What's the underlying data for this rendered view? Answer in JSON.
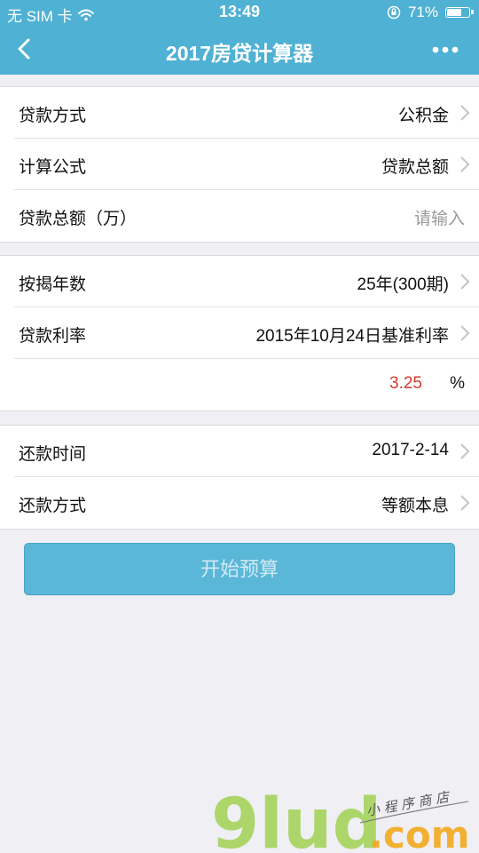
{
  "status_bar": {
    "carrier": "无 SIM 卡",
    "time": "13:49",
    "battery_percent": "71%",
    "battery_level": 0.71
  },
  "nav": {
    "title": "2017房贷计算器",
    "back_icon": "back-chevron-icon",
    "more_icon": "more-dots-icon"
  },
  "groups": [
    {
      "rows": [
        {
          "label": "贷款方式",
          "value": "公积金"
        },
        {
          "label": "计算公式",
          "value": "贷款总额"
        },
        {
          "label": "贷款总额（万）",
          "placeholder": "请输入"
        }
      ]
    },
    {
      "rows": [
        {
          "label": "按揭年数",
          "value": "25年(300期)"
        },
        {
          "label": "贷款利率",
          "value": "2015年10月24日基准利率"
        },
        {
          "rate_value": "3.25",
          "rate_unit": "%"
        }
      ]
    },
    {
      "rows": [
        {
          "label": "还款时间",
          "value": "2017-2-14"
        },
        {
          "label": "还款方式",
          "value": "等额本息"
        }
      ]
    }
  ],
  "start_button": "开始预算",
  "watermark": {
    "main": "9lud",
    "domain": ".com",
    "tagline": "小程序商店"
  },
  "colors": {
    "header": "#4fb1d3",
    "button": "#5bb7d8",
    "rate": "#d33a2f",
    "watermark_green": "#a4d35b",
    "watermark_orange": "#f2a81d"
  }
}
